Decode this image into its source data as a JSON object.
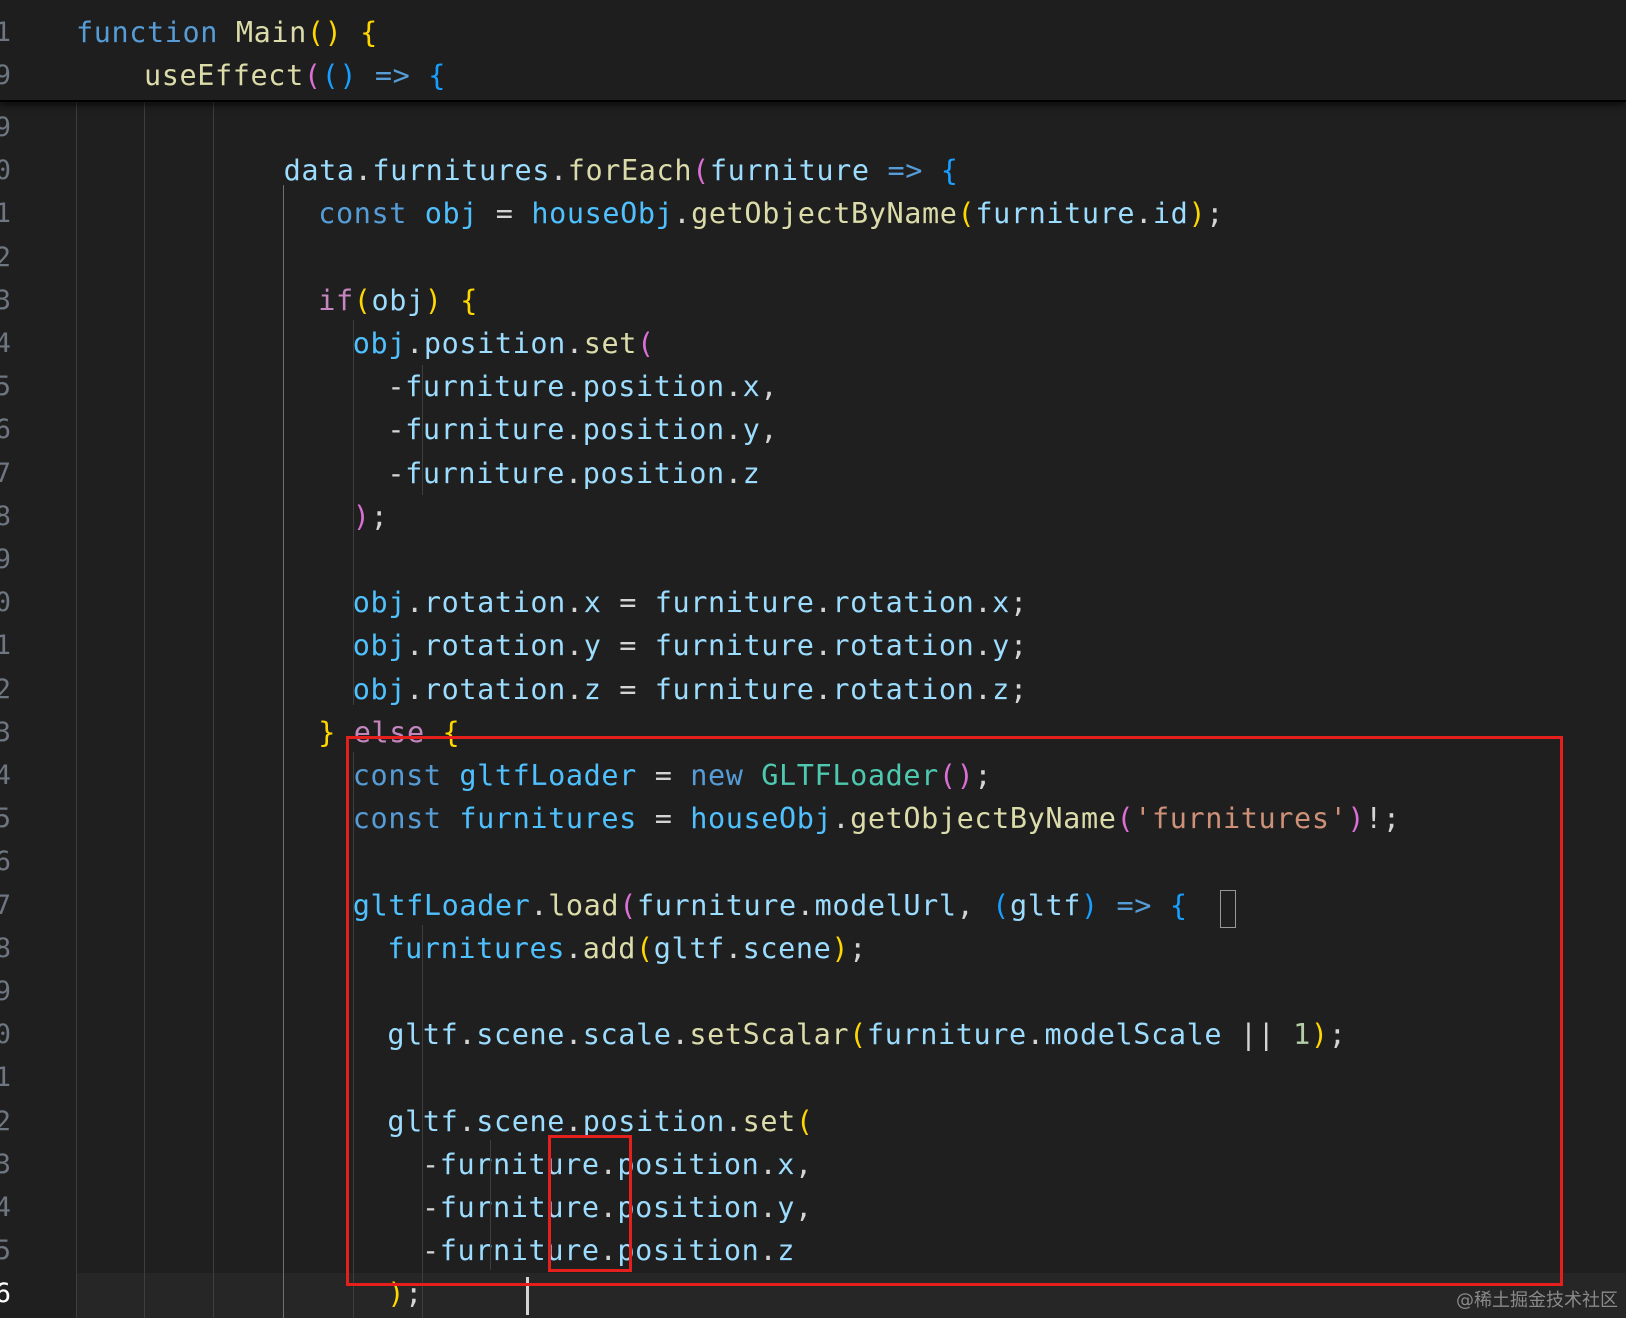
{
  "editor": {
    "sticky_scroll": [
      {
        "num": "1",
        "code": [
          [
            "kw",
            "function "
          ],
          [
            "fn",
            "Main"
          ],
          [
            "b1",
            "()"
          ],
          [
            "p",
            " "
          ],
          [
            "b1",
            "{"
          ]
        ]
      },
      {
        "num": "9",
        "code": [
          [
            "fn",
            "useEffect"
          ],
          [
            "b2",
            "("
          ],
          [
            "b3",
            "()"
          ],
          [
            "p",
            " "
          ],
          [
            "kw",
            "=>"
          ],
          [
            "p",
            " "
          ],
          [
            "b3",
            "{"
          ]
        ]
      }
    ],
    "lines": [
      {
        "num": "9",
        "code": []
      },
      {
        "num": "0",
        "code": [
          [
            "var",
            "data"
          ],
          [
            "p",
            "."
          ],
          [
            "var",
            "furnitures"
          ],
          [
            "p",
            "."
          ],
          [
            "fn",
            "forEach"
          ],
          [
            "b2",
            "("
          ],
          [
            "var",
            "furniture"
          ],
          [
            "p",
            " "
          ],
          [
            "kw",
            "=>"
          ],
          [
            "p",
            " "
          ],
          [
            "b3",
            "{"
          ]
        ]
      },
      {
        "num": "1",
        "code": [
          [
            "kw",
            "const "
          ],
          [
            "cst",
            "obj"
          ],
          [
            "p",
            " = "
          ],
          [
            "cst",
            "houseObj"
          ],
          [
            "p",
            "."
          ],
          [
            "fn",
            "getObjectByName"
          ],
          [
            "b1",
            "("
          ],
          [
            "var",
            "furniture"
          ],
          [
            "p",
            "."
          ],
          [
            "var",
            "id"
          ],
          [
            "b1",
            ")"
          ],
          [
            "p",
            ";"
          ]
        ]
      },
      {
        "num": "2",
        "code": []
      },
      {
        "num": "3",
        "code": [
          [
            "ctl",
            "if"
          ],
          [
            "b1",
            "("
          ],
          [
            "var",
            "obj"
          ],
          [
            "b1",
            ")"
          ],
          [
            "p",
            " "
          ],
          [
            "b1",
            "{"
          ]
        ]
      },
      {
        "num": "4",
        "code": [
          [
            "cst",
            "obj"
          ],
          [
            "p",
            "."
          ],
          [
            "var",
            "position"
          ],
          [
            "p",
            "."
          ],
          [
            "fn",
            "set"
          ],
          [
            "b2",
            "("
          ]
        ]
      },
      {
        "num": "5",
        "code": [
          [
            "p",
            "-"
          ],
          [
            "var",
            "furniture"
          ],
          [
            "p",
            "."
          ],
          [
            "var",
            "position"
          ],
          [
            "p",
            "."
          ],
          [
            "var",
            "x"
          ],
          [
            "p",
            ","
          ]
        ]
      },
      {
        "num": "6",
        "code": [
          [
            "p",
            "-"
          ],
          [
            "var",
            "furniture"
          ],
          [
            "p",
            "."
          ],
          [
            "var",
            "position"
          ],
          [
            "p",
            "."
          ],
          [
            "var",
            "y"
          ],
          [
            "p",
            ","
          ]
        ]
      },
      {
        "num": "7",
        "code": [
          [
            "p",
            "-"
          ],
          [
            "var",
            "furniture"
          ],
          [
            "p",
            "."
          ],
          [
            "var",
            "position"
          ],
          [
            "p",
            "."
          ],
          [
            "var",
            "z"
          ]
        ]
      },
      {
        "num": "8",
        "code": [
          [
            "b2",
            ")"
          ],
          [
            "p",
            ";"
          ]
        ]
      },
      {
        "num": "9",
        "code": []
      },
      {
        "num": "0",
        "code": [
          [
            "cst",
            "obj"
          ],
          [
            "p",
            "."
          ],
          [
            "var",
            "rotation"
          ],
          [
            "p",
            "."
          ],
          [
            "var",
            "x"
          ],
          [
            "p",
            " = "
          ],
          [
            "var",
            "furniture"
          ],
          [
            "p",
            "."
          ],
          [
            "var",
            "rotation"
          ],
          [
            "p",
            "."
          ],
          [
            "var",
            "x"
          ],
          [
            "p",
            ";"
          ]
        ]
      },
      {
        "num": "1",
        "code": [
          [
            "cst",
            "obj"
          ],
          [
            "p",
            "."
          ],
          [
            "var",
            "rotation"
          ],
          [
            "p",
            "."
          ],
          [
            "var",
            "y"
          ],
          [
            "p",
            " = "
          ],
          [
            "var",
            "furniture"
          ],
          [
            "p",
            "."
          ],
          [
            "var",
            "rotation"
          ],
          [
            "p",
            "."
          ],
          [
            "var",
            "y"
          ],
          [
            "p",
            ";"
          ]
        ]
      },
      {
        "num": "2",
        "code": [
          [
            "cst",
            "obj"
          ],
          [
            "p",
            "."
          ],
          [
            "var",
            "rotation"
          ],
          [
            "p",
            "."
          ],
          [
            "var",
            "z"
          ],
          [
            "p",
            " = "
          ],
          [
            "var",
            "furniture"
          ],
          [
            "p",
            "."
          ],
          [
            "var",
            "rotation"
          ],
          [
            "p",
            "."
          ],
          [
            "var",
            "z"
          ],
          [
            "p",
            ";"
          ]
        ]
      },
      {
        "num": "3",
        "code": [
          [
            "b1",
            "}"
          ],
          [
            "p",
            " "
          ],
          [
            "ctl",
            "else"
          ],
          [
            "p",
            " "
          ],
          [
            "b1",
            "{"
          ]
        ]
      },
      {
        "num": "4",
        "code": [
          [
            "kw",
            "const "
          ],
          [
            "cst",
            "gltfLoader"
          ],
          [
            "p",
            " = "
          ],
          [
            "kw",
            "new "
          ],
          [
            "cls",
            "GLTFLoader"
          ],
          [
            "b2",
            "()"
          ],
          [
            "p",
            ";"
          ]
        ]
      },
      {
        "num": "5",
        "code": [
          [
            "kw",
            "const "
          ],
          [
            "cst",
            "furnitures"
          ],
          [
            "p",
            " = "
          ],
          [
            "cst",
            "houseObj"
          ],
          [
            "p",
            "."
          ],
          [
            "fn",
            "getObjectByName"
          ],
          [
            "b2",
            "("
          ],
          [
            "str",
            "'furnitures'"
          ],
          [
            "b2",
            ")"
          ],
          [
            "p",
            "!;"
          ]
        ]
      },
      {
        "num": "6",
        "code": []
      },
      {
        "num": "7",
        "code": [
          [
            "cst",
            "gltfLoader"
          ],
          [
            "p",
            "."
          ],
          [
            "fn",
            "load"
          ],
          [
            "b2",
            "("
          ],
          [
            "var",
            "furniture"
          ],
          [
            "p",
            "."
          ],
          [
            "var",
            "modelUrl"
          ],
          [
            "p",
            ", "
          ],
          [
            "b3",
            "("
          ],
          [
            "var",
            "gltf"
          ],
          [
            "b3",
            ")"
          ],
          [
            "p",
            " "
          ],
          [
            "kw",
            "=>"
          ],
          [
            "p",
            " "
          ],
          [
            "b3",
            "{"
          ]
        ]
      },
      {
        "num": "8",
        "code": [
          [
            "cst",
            "furnitures"
          ],
          [
            "p",
            "."
          ],
          [
            "fn",
            "add"
          ],
          [
            "b1",
            "("
          ],
          [
            "var",
            "gltf"
          ],
          [
            "p",
            "."
          ],
          [
            "var",
            "scene"
          ],
          [
            "b1",
            ")"
          ],
          [
            "p",
            ";"
          ]
        ]
      },
      {
        "num": "9",
        "code": []
      },
      {
        "num": "0",
        "code": [
          [
            "var",
            "gltf"
          ],
          [
            "p",
            "."
          ],
          [
            "var",
            "scene"
          ],
          [
            "p",
            "."
          ],
          [
            "var",
            "scale"
          ],
          [
            "p",
            "."
          ],
          [
            "fn",
            "setScalar"
          ],
          [
            "b1",
            "("
          ],
          [
            "var",
            "furniture"
          ],
          [
            "p",
            "."
          ],
          [
            "var",
            "modelScale"
          ],
          [
            "p",
            " || "
          ],
          [
            "num",
            "1"
          ],
          [
            "b1",
            ")"
          ],
          [
            "p",
            ";"
          ]
        ]
      },
      {
        "num": "1",
        "code": []
      },
      {
        "num": "2",
        "code": [
          [
            "var",
            "gltf"
          ],
          [
            "p",
            "."
          ],
          [
            "var",
            "scene"
          ],
          [
            "p",
            "."
          ],
          [
            "var",
            "position"
          ],
          [
            "p",
            "."
          ],
          [
            "fn",
            "set"
          ],
          [
            "b1",
            "("
          ]
        ]
      },
      {
        "num": "3",
        "code": [
          [
            "p",
            "-"
          ],
          [
            "var",
            "furniture"
          ],
          [
            "p",
            "."
          ],
          [
            "var",
            "position"
          ],
          [
            "p",
            "."
          ],
          [
            "var",
            "x"
          ],
          [
            "p",
            ","
          ]
        ]
      },
      {
        "num": "4",
        "code": [
          [
            "p",
            "-"
          ],
          [
            "var",
            "furniture"
          ],
          [
            "p",
            "."
          ],
          [
            "var",
            "position"
          ],
          [
            "p",
            "."
          ],
          [
            "var",
            "y"
          ],
          [
            "p",
            ","
          ]
        ]
      },
      {
        "num": "5",
        "code": [
          [
            "p",
            "-"
          ],
          [
            "var",
            "furniture"
          ],
          [
            "p",
            "."
          ],
          [
            "var",
            "position"
          ],
          [
            "p",
            "."
          ],
          [
            "var",
            "z"
          ]
        ]
      },
      {
        "num": "6",
        "code": [
          [
            "b1",
            ")"
          ],
          [
            "p",
            ";"
          ]
        ]
      }
    ]
  },
  "watermark": "@稀土掘金技术社区",
  "colors": {
    "background": "#1f1f1f",
    "keyword": "#569cd6",
    "control": "#c586c0",
    "function": "#dcdcaa",
    "variable": "#9cdcfe",
    "constant": "#4fc1ff",
    "class": "#4ec9b0",
    "string": "#ce9178",
    "number": "#b5cea8",
    "bracket_gold": "#ffd700",
    "bracket_orchid": "#da70d6",
    "bracket_blue": "#179fff",
    "annotation": "#e5201c"
  }
}
